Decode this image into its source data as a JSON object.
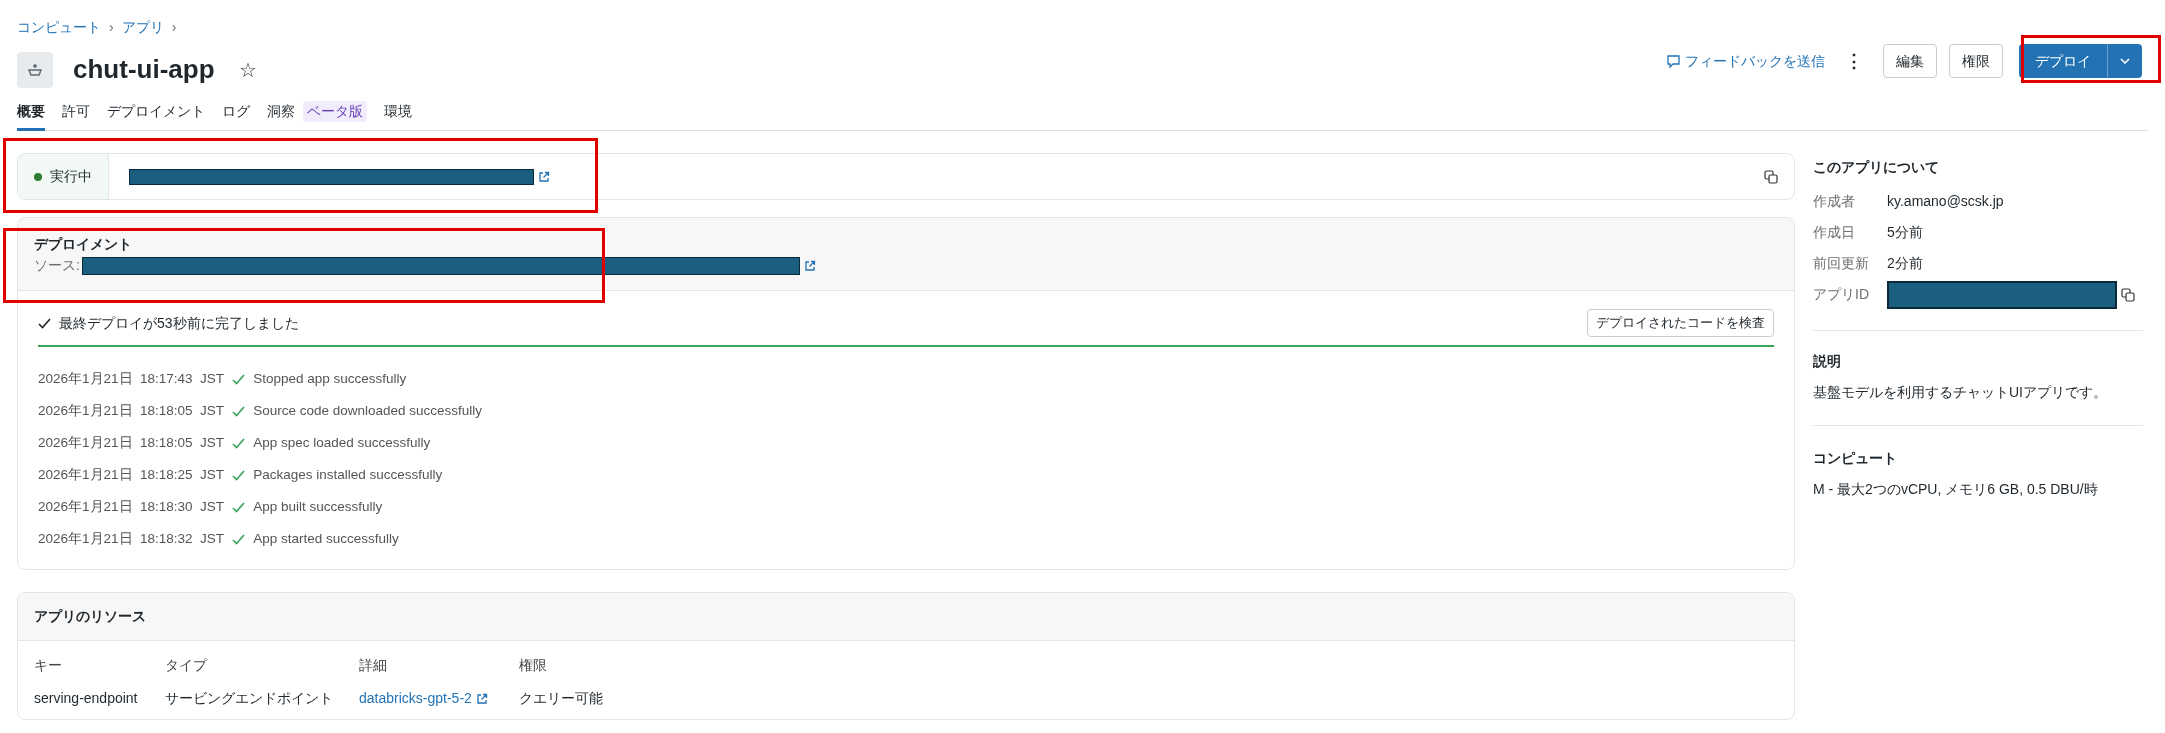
{
  "breadcrumb": [
    {
      "label": "コンピュート",
      "separator": "›"
    },
    {
      "label": "アプリ",
      "separator": "›"
    }
  ],
  "app": {
    "name": "chut-ui-app",
    "star": "☆",
    "starred": false
  },
  "actions": {
    "feedback": "フィードバックを送信",
    "more": "⋮",
    "edit": "編集",
    "permissions": "権限",
    "deploy": "デプロイ"
  },
  "tabs": [
    {
      "label": "概要",
      "selected": true
    },
    {
      "label": "許可",
      "selected": false
    },
    {
      "label": "デプロイメント",
      "selected": false
    },
    {
      "label": "ログ",
      "selected": false
    },
    {
      "label": "洞察",
      "badge": "ベータ版",
      "selected": false
    },
    {
      "label": "環境",
      "selected": false
    }
  ],
  "status": {
    "label": "実行中",
    "color": "#2e7d32"
  },
  "deployment": {
    "title": "デプロイメント",
    "source_label": "ソース:",
    "summary": "最終デプロイが53秒前に完了しました",
    "inspect_button": "デプロイされたコードを検査",
    "level": 1,
    "log": [
      {
        "time": "2026年1月21日  18:17:43  JST",
        "message": "Stopped app successfully"
      },
      {
        "time": "2026年1月21日  18:18:05  JST",
        "message": "Source code downloaded successfully"
      },
      {
        "time": "2026年1月21日  18:18:05  JST",
        "message": "App spec loaded successfully"
      },
      {
        "time": "2026年1月21日  18:18:25  JST",
        "message": "Packages installed successfully"
      },
      {
        "time": "2026年1月21日  18:18:30  JST",
        "message": "App built successfully"
      },
      {
        "time": "2026年1月21日  18:18:32  JST",
        "message": "App started successfully"
      }
    ]
  },
  "resources": {
    "title": "アプリのリソース",
    "columns": [
      "キー",
      "タイプ",
      "詳細",
      "権限"
    ],
    "rows": [
      {
        "key": "serving-endpoint",
        "type": "サービングエンドポイント",
        "detail": "databricks-gpt-5-2",
        "permission": "クエリー可能"
      }
    ]
  },
  "about": {
    "title": "このアプリについて",
    "fields": [
      {
        "label": "作成者",
        "value": "ky.amano@scsk.jp"
      },
      {
        "label": "作成日",
        "value": "5分前"
      },
      {
        "label": "前回更新",
        "value": "2分前"
      },
      {
        "label": "アプリID",
        "kind": "redacted"
      }
    ],
    "description_title": "説明",
    "description": "基盤モデルを利用するチャットUIアプリです。",
    "compute_title": "コンピュート",
    "compute": "M - 最大2つのvCPU, メモリ6 GB, 0.5 DBU/時"
  }
}
